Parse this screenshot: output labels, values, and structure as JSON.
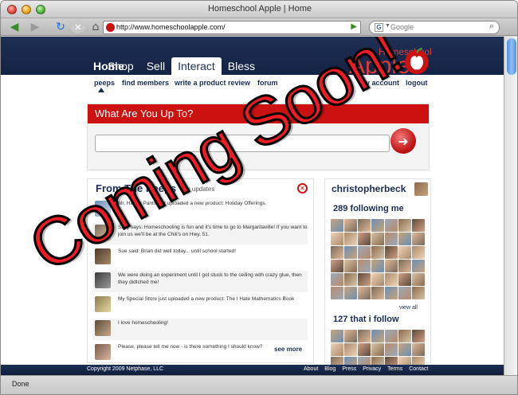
{
  "browser": {
    "window_title": "Homeschool Apple | Home",
    "url": "http://www.homeschoolapple.com/",
    "search_placeholder": "Google",
    "status_text": "Done"
  },
  "site": {
    "logo_small": "Homeschool",
    "logo_big": "Apple",
    "nav": [
      {
        "label": "Home"
      },
      {
        "label": "Shop"
      },
      {
        "label": "Sell"
      },
      {
        "label": "Interact"
      },
      {
        "label": "Bless"
      }
    ],
    "subnav_left": [
      {
        "label": "peeps"
      },
      {
        "label": "find members"
      },
      {
        "label": "write a product review"
      },
      {
        "label": "forum"
      }
    ],
    "subnav_right": [
      {
        "label": "my account"
      },
      {
        "label": "logout"
      }
    ],
    "what_are_you_up_to": {
      "title": "What Are You Up To?"
    },
    "peeps": {
      "title": "From The Peeps",
      "tab_label": "my updates",
      "feed": [
        {
          "text": "Mr. Happy Pants just uploaded a new product: Holiday Offerings."
        },
        {
          "text": "Sally says: Homeschooling is fun and it's time to go to Margaritaville! If you want to join us we'll be at the Chili's on Hwy. 51."
        },
        {
          "text": "Sue said: Brian did well today... until school started!"
        },
        {
          "text": "We were doing an experiment until I got stuck to the ceiling with crazy glue, then they didtched me!"
        },
        {
          "text": "My Special Store just uploaded a new product: The I Hate Mathematics Book"
        },
        {
          "text": "I love homeschooling!"
        },
        {
          "text": "Please, please tell me now - is there something I should know?"
        }
      ],
      "see_more": "see more"
    },
    "user": {
      "name": "christopherbeck",
      "following_count": "289 following me",
      "follow_count": "127 that i follow",
      "view_all": "view all"
    },
    "footer": {
      "copyright": "Copyright 2009 Netphase, LLC",
      "links": [
        {
          "label": "About"
        },
        {
          "label": "Blog"
        },
        {
          "label": "Press"
        },
        {
          "label": "Privacy"
        },
        {
          "label": "Terms"
        },
        {
          "label": "Contact"
        }
      ]
    },
    "stamp": "Coming Soon!"
  },
  "colors": {
    "brand_red": "#cc1111",
    "navy": "#1c2d55",
    "stamp_red": "#ee1c24"
  }
}
